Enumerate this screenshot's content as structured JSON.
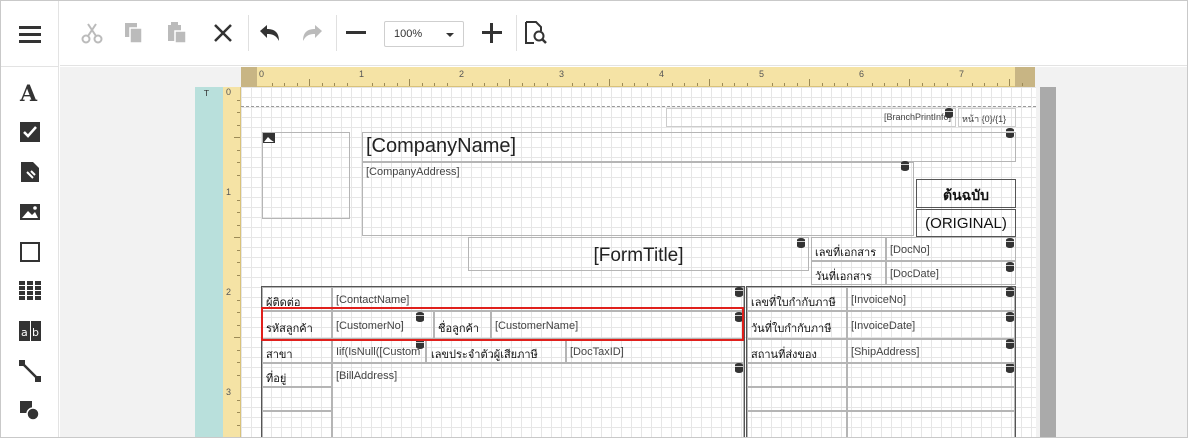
{
  "toolbar": {
    "zoom_value": "100%",
    "buttons": [
      "cut-icon",
      "copy-icon",
      "paste-icon",
      "delete-icon",
      "undo-icon",
      "redo-icon",
      "zoom-out-icon",
      "zoom-in-icon",
      "preview-icon"
    ]
  },
  "toolbox": {
    "items": [
      "menu-icon",
      "label-icon",
      "checkbox-icon",
      "richtext-icon",
      "picture-icon",
      "panel-icon",
      "table-icon",
      "character-comb-icon",
      "line-icon",
      "shape-icon"
    ]
  },
  "ruler": {
    "h_numbers": [
      "0",
      "1",
      "2",
      "3",
      "4",
      "5",
      "6",
      "7"
    ],
    "v_numbers": [
      "0",
      "1",
      "2",
      "3"
    ]
  },
  "band": {
    "label": "T"
  },
  "report": {
    "branch": "[BranchPrintInfo]",
    "page": "หน้า {0}/{1}",
    "company_name": "[CompanyName]",
    "company_address": "[CompanyAddress]",
    "original_th": "ต้นฉบับ",
    "original_en": "(ORIGINAL)",
    "form_title": "[FormTitle]",
    "docno_label": "เลขที่เอกสาร",
    "docno_value": "[DocNo]",
    "docdate_label": "วันที่เอกสาร",
    "docdate_value": "[DocDate]",
    "contact_label": "ผู้ติดต่อ",
    "contact_value": "[ContactName]",
    "invno_label": "เลขที่ใบกำกับภาษี",
    "invno_value": "[InvoiceNo]",
    "custcode_label": "รหัสลูกค้า",
    "custcode_value": "[CustomerNo]",
    "custname_label": "ชื่อลูกค้า",
    "custname_value": "[CustomerName]",
    "invdate_label": "วันที่ใบกำกับภาษี",
    "invdate_value": "[InvoiceDate]",
    "branch_label": "สาขา",
    "branch_value": "Iif(IsNull([Custom",
    "taxid_label": "เลขประจำตัวผู้เสียภาษี",
    "taxid_value": "[DocTaxID]",
    "ship_label": "สถานที่ส่งของ",
    "ship_value": "[ShipAddress]",
    "address_label": "ที่อยู่",
    "address_value": "[BillAddress]"
  }
}
